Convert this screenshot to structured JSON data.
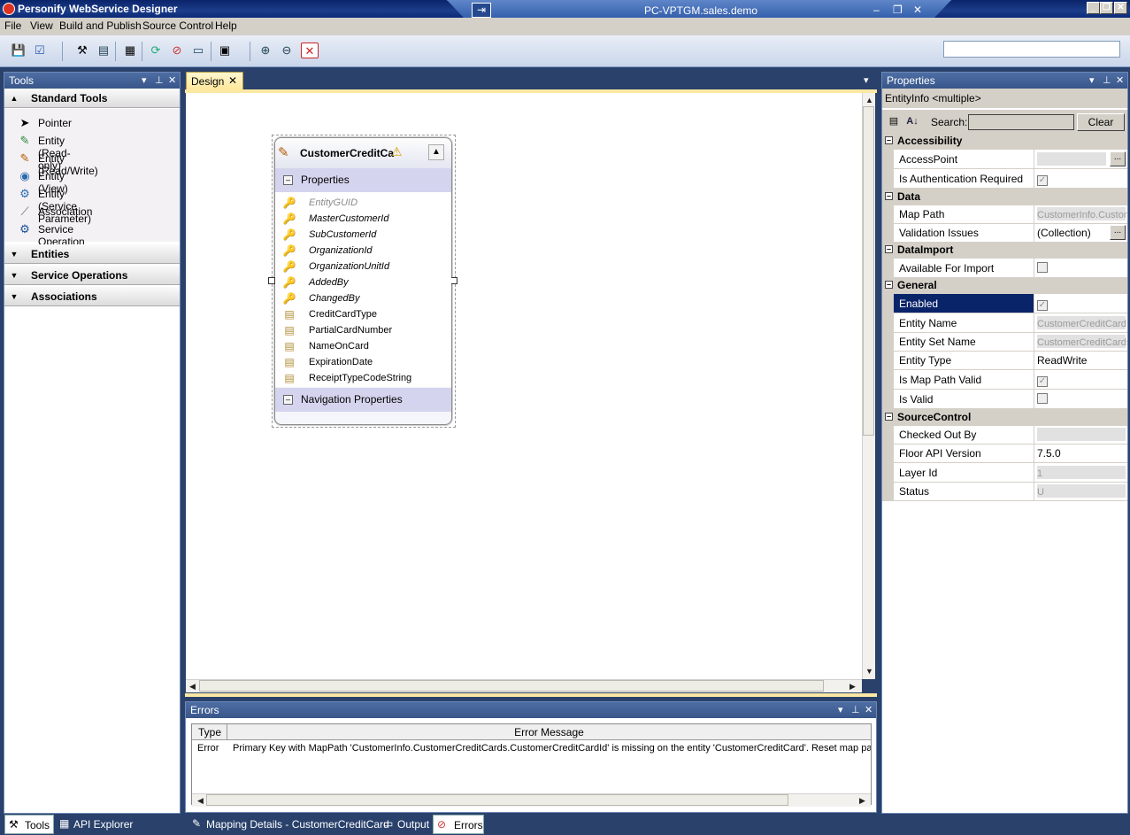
{
  "window": {
    "title": "Personify WebService Designer",
    "remote_host": "PC-VPTGM.sales.demo"
  },
  "menu": [
    "File",
    "View",
    "Build and Publish",
    "Source Control",
    "Help"
  ],
  "tools_pane": {
    "title": "Tools",
    "sections": {
      "standard": "Standard Tools",
      "entities": "Entities",
      "service_operations": "Service Operations",
      "associations": "Associations"
    },
    "items": [
      {
        "label": "Pointer",
        "icon": "pointer-icon"
      },
      {
        "label": "Entity (Read-only)",
        "icon": "entity-readonly-icon"
      },
      {
        "label": "Entity (Read/Write)",
        "icon": "entity-readwrite-icon"
      },
      {
        "label": "Entity (View)",
        "icon": "entity-view-icon"
      },
      {
        "label": "Entity (Service Parameter)",
        "icon": "entity-service-parameter-icon"
      },
      {
        "label": "Association",
        "icon": "association-icon"
      },
      {
        "label": "Service Operation",
        "icon": "service-operation-icon"
      }
    ]
  },
  "design": {
    "tab_label": "Design",
    "entity": {
      "name": "CustomerCreditCa",
      "properties_header": "Properties",
      "navigation_header": "Navigation Properties",
      "properties": [
        "EntityGUID",
        "MasterCustomerId",
        "SubCustomerId",
        "OrganizationId",
        "OrganizationUnitId",
        "AddedBy",
        "ChangedBy",
        "CreditCardType",
        "PartialCardNumber",
        "NameOnCard",
        "ExpirationDate",
        "ReceiptTypeCodeString"
      ]
    }
  },
  "properties_pane": {
    "title": "Properties",
    "subject": "EntityInfo <multiple>",
    "search_label": "Search:",
    "clear_label": "Clear",
    "categories": {
      "accessibility": "Accessibility",
      "data": "Data",
      "dataimport": "DataImport",
      "general": "General",
      "sourcecontrol": "SourceControl"
    },
    "rows": {
      "access_point": {
        "name": "AccessPoint",
        "value": ""
      },
      "is_auth_required": {
        "name": "Is Authentication Required"
      },
      "map_path": {
        "name": "Map Path",
        "value": "CustomerInfo.Custon"
      },
      "validation_issues": {
        "name": "Validation Issues",
        "value": "(Collection)"
      },
      "available_for_import": {
        "name": "Available For Import"
      },
      "enabled": {
        "name": "Enabled"
      },
      "entity_name": {
        "name": "Entity Name",
        "value": "CustomerCreditCard"
      },
      "entity_set_name": {
        "name": "Entity Set Name",
        "value": "CustomerCreditCards"
      },
      "entity_type": {
        "name": "Entity Type",
        "value": "ReadWrite"
      },
      "is_map_path_valid": {
        "name": "Is Map Path Valid"
      },
      "is_valid": {
        "name": "Is Valid"
      },
      "checked_out_by": {
        "name": "Checked Out By",
        "value": ""
      },
      "floor_api_version": {
        "name": "Floor API Version",
        "value": "7.5.0"
      },
      "layer_id": {
        "name": "Layer Id",
        "value": "1"
      },
      "status": {
        "name": "Status",
        "value": "U"
      }
    }
  },
  "errors_pane": {
    "title": "Errors",
    "columns": [
      "Type",
      "Error Message"
    ],
    "rows": [
      {
        "type": "Error",
        "message": "Primary Key with MapPath 'CustomerInfo.CustomerCreditCards.CustomerCreditCardId' is missing on the entity 'CustomerCreditCard'. Reset map path"
      }
    ]
  },
  "bottom_tabs": {
    "tools": "Tools",
    "api_explorer": "API Explorer",
    "mapping_details": "Mapping Details - CustomerCreditCard",
    "output": "Output",
    "errors": "Errors"
  }
}
